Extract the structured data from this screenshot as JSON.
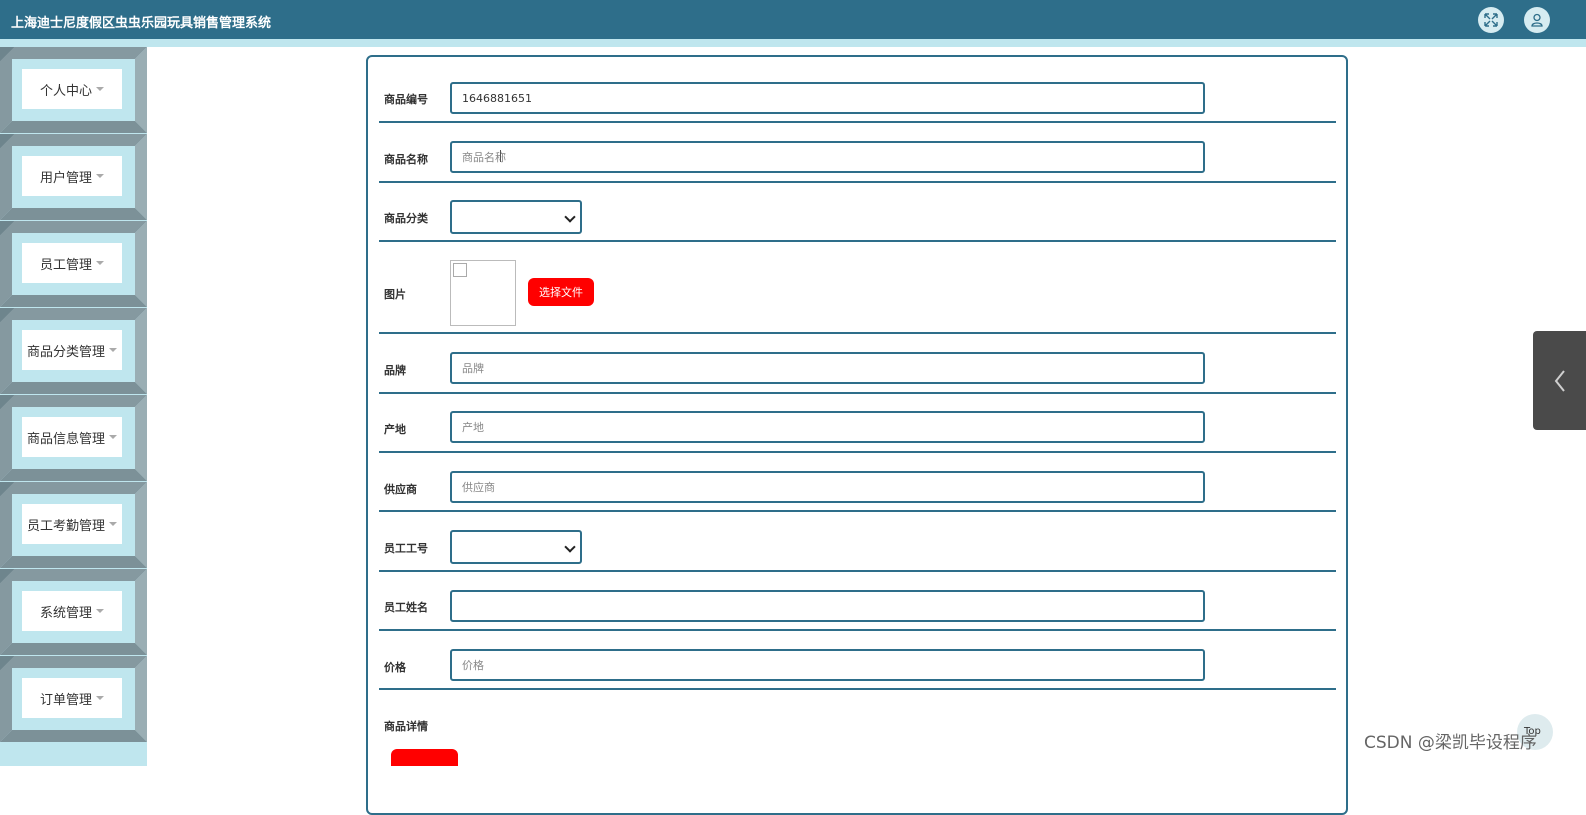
{
  "app": {
    "title": "上海迪士尼度假区虫虫乐园玩具销售管理系统",
    "icons": [
      "fullscreen-icon",
      "user-icon"
    ]
  },
  "colors": {
    "topbar": "#2e6e8a",
    "sidebar": "#bfe6ee",
    "accent_border": "#2e6e8a",
    "button_red": "#ff0000"
  },
  "sidebar": {
    "items": [
      {
        "label": "个人中心"
      },
      {
        "label": "用户管理"
      },
      {
        "label": "员工管理"
      },
      {
        "label": "商品分类管理"
      },
      {
        "label": "商品信息管理"
      },
      {
        "label": "员工考勤管理"
      },
      {
        "label": "系统管理"
      },
      {
        "label": "订单管理"
      }
    ]
  },
  "form": {
    "goods_no": {
      "label": "商品编号",
      "value": "1646881651"
    },
    "goods_name": {
      "label": "商品名称",
      "placeholder": "商品名称",
      "value": ""
    },
    "category": {
      "label": "商品分类",
      "value": ""
    },
    "image": {
      "label": "图片",
      "button": "选择文件"
    },
    "brand": {
      "label": "品牌",
      "placeholder": "品牌",
      "value": ""
    },
    "origin": {
      "label": "产地",
      "placeholder": "产地",
      "value": ""
    },
    "supplier": {
      "label": "供应商",
      "placeholder": "供应商",
      "value": ""
    },
    "employee_no": {
      "label": "员工工号",
      "value": ""
    },
    "employee_name": {
      "label": "员工姓名",
      "value": ""
    },
    "price": {
      "label": "价格",
      "placeholder": "价格",
      "value": ""
    },
    "details": {
      "label": "商品详情"
    }
  },
  "watermark": "CSDN @梁凯毕设程序",
  "float_label": "Top"
}
